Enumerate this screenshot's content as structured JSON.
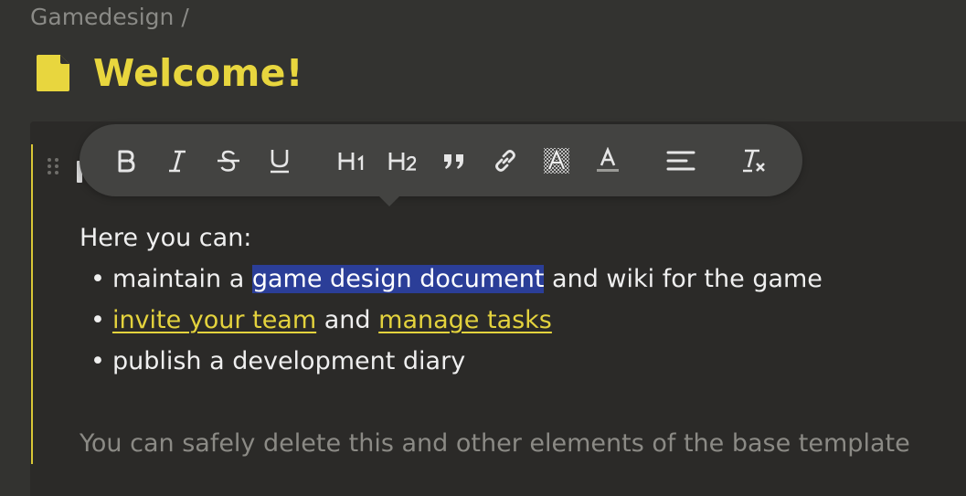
{
  "breadcrumb": {
    "workspace": "Gamedesign",
    "separator": "/"
  },
  "page": {
    "title": "Welcome!",
    "icon": "note-icon"
  },
  "toolbar": {
    "buttons": [
      {
        "name": "bold",
        "label": "B"
      },
      {
        "name": "italic",
        "label": "I"
      },
      {
        "name": "strikethrough",
        "label": "S"
      },
      {
        "name": "underline",
        "label": "U"
      },
      {
        "name": "heading-1",
        "label": "H1"
      },
      {
        "name": "heading-2",
        "label": "H2"
      },
      {
        "name": "quote",
        "icon": "quote-icon"
      },
      {
        "name": "link",
        "icon": "link-icon"
      },
      {
        "name": "highlight",
        "icon": "highlight-icon"
      },
      {
        "name": "text-color",
        "icon": "text-color-icon"
      },
      {
        "name": "align",
        "icon": "align-icon"
      },
      {
        "name": "clear-format",
        "icon": "clear-format-icon"
      }
    ]
  },
  "content": {
    "intro": "Here you can:",
    "bullet": "•",
    "items": [
      {
        "before": "maintain a",
        "selected": "game design document",
        "after": "and wiki for the game"
      },
      {
        "link1": "invite your team",
        "middle": "and",
        "link2": "manage tasks"
      },
      {
        "text": "publish a development diary"
      }
    ],
    "hint": "You can safely delete this and other elements of the base template"
  },
  "colors": {
    "accent": "#e8d63e",
    "selection": "#2b3e98",
    "background": "#333330",
    "editor": "#2b2a28",
    "toolbar": "#434341"
  }
}
